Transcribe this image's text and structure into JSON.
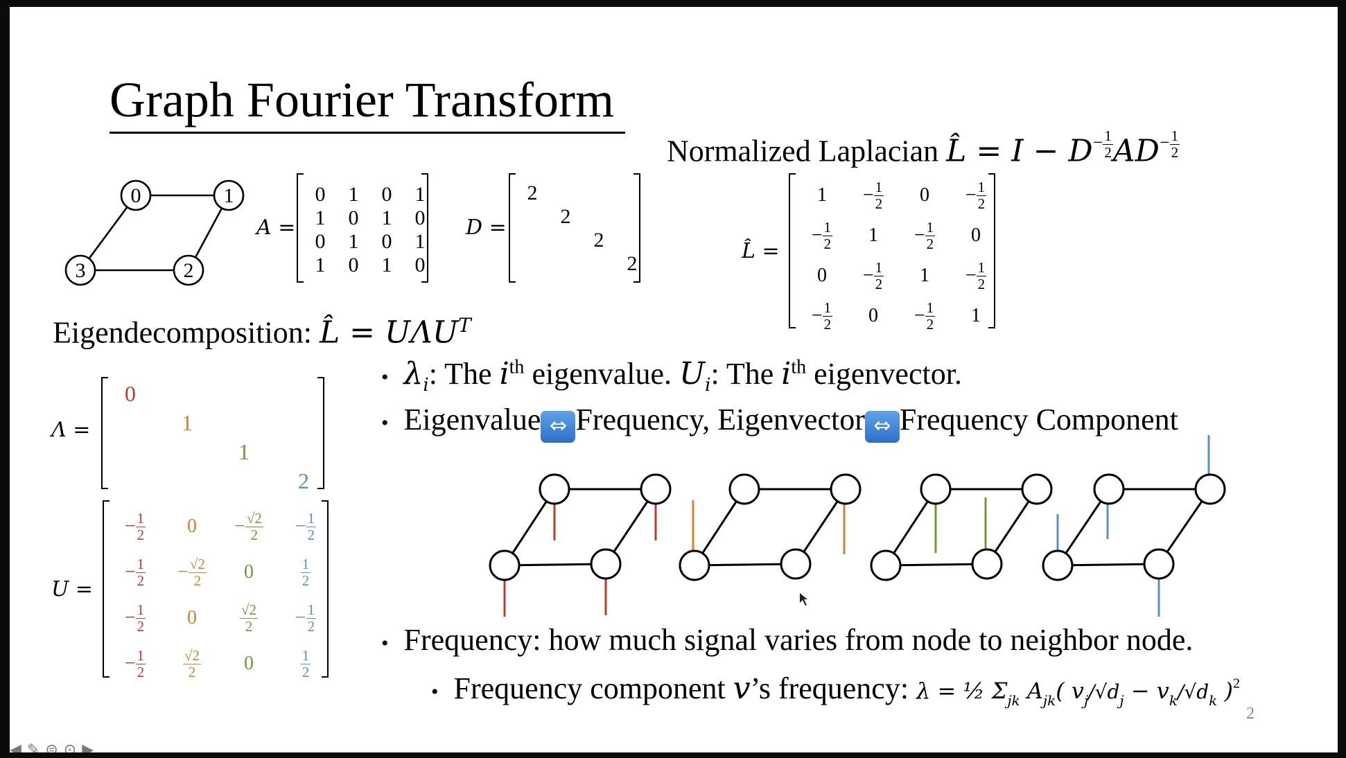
{
  "slide": {
    "title": "Graph Fourier Transform",
    "page_number": "2"
  },
  "graph": {
    "nodes": [
      "0",
      "1",
      "2",
      "3"
    ]
  },
  "adjacency": {
    "label": "A =",
    "rows": [
      [
        "0",
        "1",
        "0",
        "1"
      ],
      [
        "1",
        "0",
        "1",
        "0"
      ],
      [
        "0",
        "1",
        "0",
        "1"
      ],
      [
        "1",
        "0",
        "1",
        "0"
      ]
    ]
  },
  "degree": {
    "label": "D =",
    "diagonal": [
      "2",
      "2",
      "2",
      "2"
    ]
  },
  "laplacian": {
    "heading_text": "Normalized Laplacian",
    "heading_formula": "L̂ = I − D",
    "exp_minus": "−",
    "exp_num": "1",
    "exp_den": "2",
    "mid": "AD",
    "label": "L̂ =",
    "rows": [
      [
        "1",
        "−1/2",
        "0",
        "−1/2"
      ],
      [
        "−1/2",
        "1",
        "−1/2",
        "0"
      ],
      [
        "0",
        "−1/2",
        "1",
        "−1/2"
      ],
      [
        "−1/2",
        "0",
        "−1/2",
        "1"
      ]
    ]
  },
  "eigen": {
    "heading_text": "Eigendecomposition:",
    "heading_formula": "L̂ = UΛU",
    "heading_sup": "T",
    "lambda_label": "Λ =",
    "lambda_diag": [
      "0",
      "1",
      "1",
      "2"
    ],
    "u_label": "U =",
    "u_rows": [
      [
        "−1/2",
        "0",
        "−√2/2",
        "−1/2"
      ],
      [
        "−1/2",
        "−√2/2",
        "0",
        "1/2"
      ],
      [
        "−1/2",
        "0",
        "√2/2",
        "−1/2"
      ],
      [
        "−1/2",
        "√2/2",
        "0",
        "1/2"
      ]
    ],
    "column_colors": [
      "#c0392b",
      "#d4822a",
      "#6d9a36",
      "#5b8fc8"
    ]
  },
  "bullets": {
    "b1_lambda": "λ",
    "b1_i": "i",
    "b1_text1": ": The ",
    "b1_ith": "i",
    "b1_th": "th",
    "b1_text2": " eigenvalue. ",
    "b1_U": "U",
    "b1_Ui": "i",
    "b1_text3": ": The ",
    "b1_ith2": "i",
    "b1_th2": "th",
    "b1_text4": " eigenvector.",
    "b2_part1": "Eigenvalue",
    "b2_part2": "Frequency, Eigenvector",
    "b2_part3": "Frequency Component",
    "swap_icon": "left-right-arrow",
    "b3": "Frequency: how much signal varies from node to neighbor node.",
    "b4_text": "Frequency component ",
    "b4_v": "v",
    "b4_text2": "’s frequency: ",
    "b4_formula": "λ = ½ Σ",
    "b4_sub": "jk",
    "b4_A": " A",
    "b4_Asub": "jk",
    "b4_paren": "( v",
    "b4_vj": "j",
    "b4_sqrt_dj": "/√d",
    "b4_dj": "j",
    "b4_minus": " − v",
    "b4_vk": "k",
    "b4_sqrt_dk": "/√d",
    "b4_dk": "k",
    "b4_close": " )",
    "b4_sq": "2"
  },
  "toolbar": [
    "prev",
    "pen",
    "menu",
    "more",
    "next"
  ]
}
